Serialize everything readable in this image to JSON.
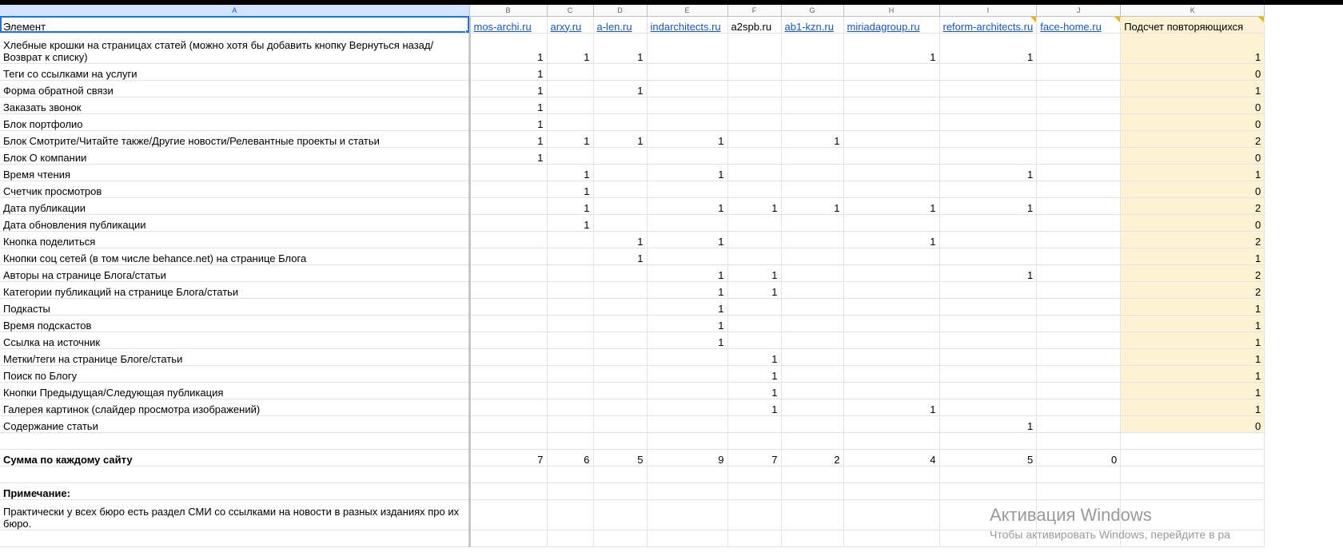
{
  "columns": [
    "A",
    "B",
    "C",
    "D",
    "E",
    "F",
    "G",
    "H",
    "I",
    "J",
    "K"
  ],
  "header": {
    "element": "Элемент",
    "sites": [
      "mos-archi.ru",
      "arxy.ru",
      "a-len.ru",
      "indarchitects.ru",
      "a2spb.ru",
      "ab1-kzn.ru",
      "miriadagroup.ru",
      "reform-architects.ru",
      "face-home.ru"
    ],
    "count": "Подсчет повторяющихся"
  },
  "rows": [
    {
      "label": "Хлебные крошки на страницах статей (можно хотя бы добавить кнопку Вернуться назад/Возврат к списку)",
      "v": [
        "1",
        "1",
        "1",
        "",
        "",
        "",
        "1",
        "1",
        ""
      ],
      "k": "1"
    },
    {
      "label": "Теги со ссылками на услуги",
      "v": [
        "1",
        "",
        "",
        "",
        "",
        "",
        "",
        "",
        ""
      ],
      "k": "0"
    },
    {
      "label": "Форма обратной связи",
      "v": [
        "1",
        "",
        "1",
        "",
        "",
        "",
        "",
        "",
        ""
      ],
      "k": "1"
    },
    {
      "label": "Заказать звонок",
      "v": [
        "1",
        "",
        "",
        "",
        "",
        "",
        "",
        "",
        ""
      ],
      "k": "0"
    },
    {
      "label": "Блок портфолио",
      "v": [
        "1",
        "",
        "",
        "",
        "",
        "",
        "",
        "",
        ""
      ],
      "k": "0"
    },
    {
      "label": "Блок Смотрите/Читайте также/Другие новости/Релевантные проекты и статьи",
      "v": [
        "1",
        "1",
        "1",
        "1",
        "",
        "1",
        "",
        "",
        ""
      ],
      "k": "2"
    },
    {
      "label": "Блок О компании",
      "v": [
        "1",
        "",
        "",
        "",
        "",
        "",
        "",
        "",
        ""
      ],
      "k": "0"
    },
    {
      "label": "Время чтения",
      "v": [
        "",
        "1",
        "",
        "1",
        "",
        "",
        "",
        "1",
        ""
      ],
      "k": "1"
    },
    {
      "label": "Счетчик просмотров",
      "v": [
        "",
        "1",
        "",
        "",
        "",
        "",
        "",
        "",
        ""
      ],
      "k": "0"
    },
    {
      "label": "Дата публикации",
      "v": [
        "",
        "1",
        "",
        "1",
        "1",
        "1",
        "1",
        "1",
        ""
      ],
      "k": "2"
    },
    {
      "label": "Дата обновления публикации",
      "v": [
        "",
        "1",
        "",
        "",
        "",
        "",
        "",
        "",
        ""
      ],
      "k": "0"
    },
    {
      "label": "Кнопка поделиться",
      "v": [
        "",
        "",
        "1",
        "1",
        "",
        "",
        "1",
        "",
        ""
      ],
      "k": "2"
    },
    {
      "label": "Кнопки соц сетей (в том числе behance.net) на странице Блога",
      "v": [
        "",
        "",
        "1",
        "",
        "",
        "",
        "",
        "",
        ""
      ],
      "k": "1"
    },
    {
      "label": "Авторы на странице Блога/статьи",
      "v": [
        "",
        "",
        "",
        "1",
        "1",
        "",
        "",
        "1",
        ""
      ],
      "k": "2"
    },
    {
      "label": "Категории публикаций на странице Блога/статьи",
      "v": [
        "",
        "",
        "",
        "1",
        "1",
        "",
        "",
        "",
        ""
      ],
      "k": "2"
    },
    {
      "label": "Подкасты",
      "v": [
        "",
        "",
        "",
        "1",
        "",
        "",
        "",
        "",
        ""
      ],
      "k": "1"
    },
    {
      "label": "Время подскастов",
      "v": [
        "",
        "",
        "",
        "1",
        "",
        "",
        "",
        "",
        ""
      ],
      "k": "1"
    },
    {
      "label": "Ссылка на источник",
      "v": [
        "",
        "",
        "",
        "1",
        "",
        "",
        "",
        "",
        ""
      ],
      "k": "1"
    },
    {
      "label": "Метки/теги на странице Блоге/статьи",
      "v": [
        "",
        "",
        "",
        "",
        "1",
        "",
        "",
        "",
        ""
      ],
      "k": "1"
    },
    {
      "label": "Поиск по Блогу",
      "v": [
        "",
        "",
        "",
        "",
        "1",
        "",
        "",
        "",
        ""
      ],
      "k": "1"
    },
    {
      "label": "Кнопки Предыдущая/Следующая публикация",
      "v": [
        "",
        "",
        "",
        "",
        "1",
        "",
        "",
        "",
        ""
      ],
      "k": "1"
    },
    {
      "label": "Галерея картинок (слайдер просмотра изображений)",
      "v": [
        "",
        "",
        "",
        "",
        "1",
        "",
        "1",
        "",
        ""
      ],
      "k": "1"
    },
    {
      "label": "Содержание статьи",
      "v": [
        "",
        "",
        "",
        "",
        "",
        "",
        "",
        "1",
        ""
      ],
      "k": "0"
    }
  ],
  "sum": {
    "label": "Сумма по каждому сайту",
    "v": [
      "7",
      "6",
      "5",
      "9",
      "7",
      "2",
      "4",
      "5",
      "0"
    ]
  },
  "note": {
    "label": "Примечание:",
    "text": "Практически у всех бюро есть раздел СМИ со ссылками на новости в разных изданиях про их бюро."
  },
  "watermark": {
    "title": "Активация Windows",
    "subtitle": "Чтобы активировать Windows, перейдите в ра"
  }
}
